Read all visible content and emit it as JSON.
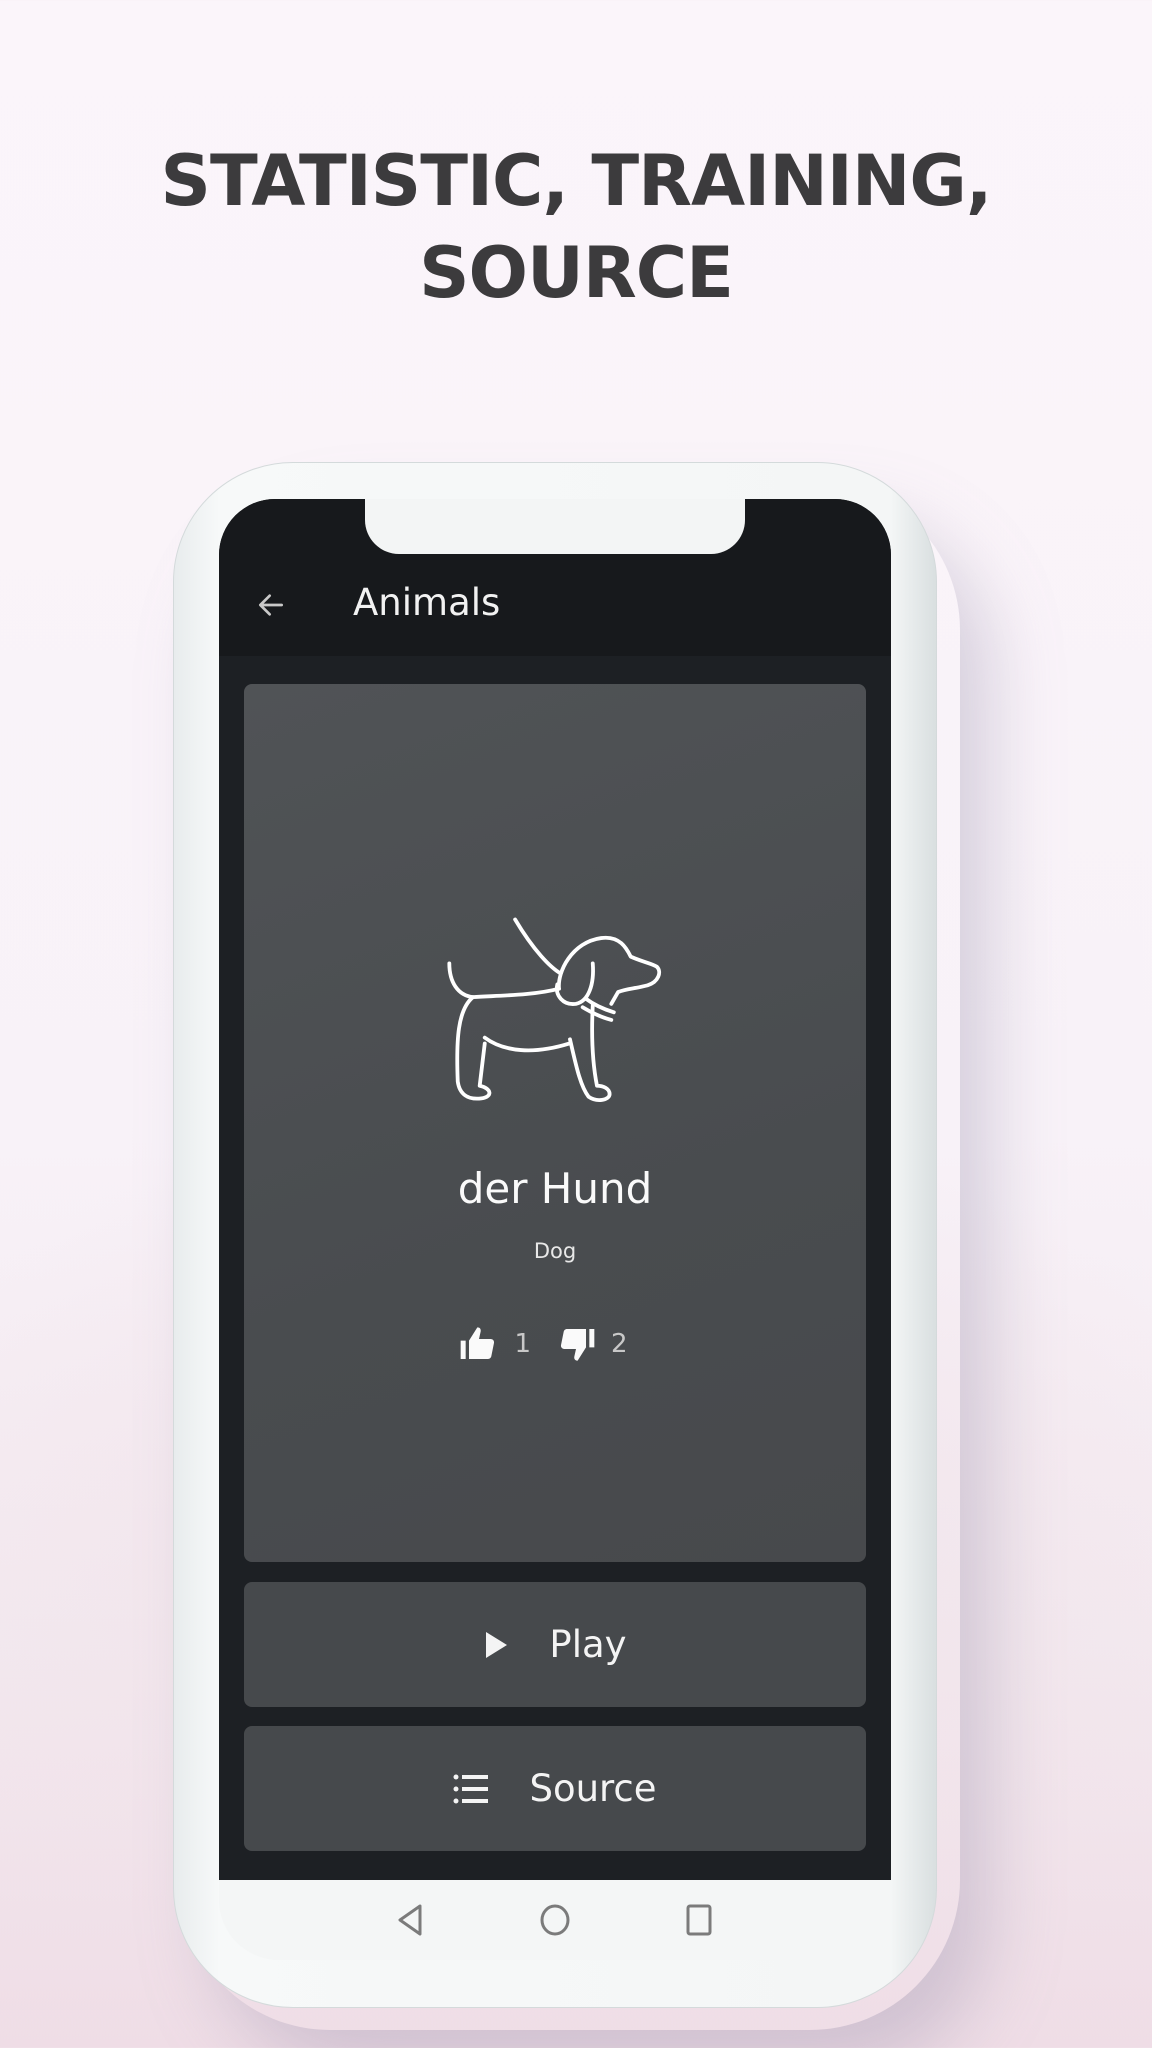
{
  "headline": {
    "line1": "STATISTIC, TRAINING,",
    "line2": "SOURCE"
  },
  "app": {
    "title": "Animals",
    "back_icon": "arrow-left-icon",
    "card": {
      "image_icon": "dog-on-leash-icon",
      "word": "der Hund",
      "translation": "Dog",
      "likes": {
        "icon": "thumbs-up-icon",
        "count": "1"
      },
      "dislikes": {
        "icon": "thumbs-down-icon",
        "count": "2"
      }
    },
    "buttons": {
      "play": {
        "icon": "play-icon",
        "label": "Play"
      },
      "source": {
        "icon": "list-icon",
        "label": "Source"
      }
    },
    "navbar": {
      "back": "nav-back-icon",
      "home": "nav-home-icon",
      "recents": "nav-recents-icon"
    }
  },
  "colors": {
    "screen_bg": "#1d2024",
    "card_bg": "#4b4e51",
    "button_bg": "#46494c",
    "headline": "#3c3b3d"
  }
}
